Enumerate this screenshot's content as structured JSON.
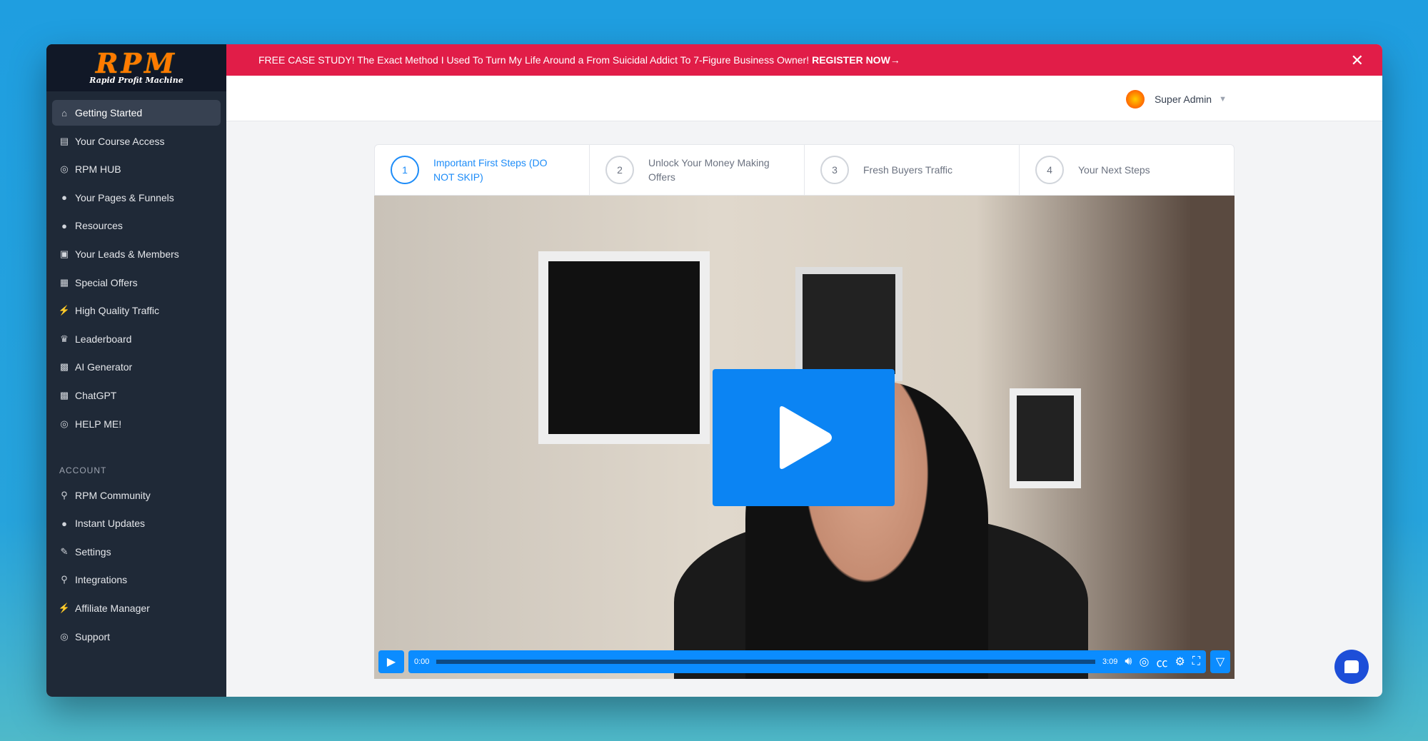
{
  "logo": {
    "main": "RPM",
    "tagline": "Rapid Profit Machine"
  },
  "banner": {
    "text": "FREE CASE STUDY! The Exact Method I Used To Turn My Life Around a From Suicidal Addict To 7-Figure Business Owner!",
    "cta": "REGISTER NOW→",
    "close": "✕"
  },
  "header": {
    "user": "Super Admin"
  },
  "sidebar": {
    "items": [
      {
        "label": "Getting Started",
        "icon": "⌂"
      },
      {
        "label": "Your Course Access",
        "icon": "▤"
      },
      {
        "label": "RPM HUB",
        "icon": "◎"
      },
      {
        "label": "Your Pages & Funnels",
        "icon": "●"
      },
      {
        "label": "Resources",
        "icon": "●"
      },
      {
        "label": "Your Leads & Members",
        "icon": "▣"
      },
      {
        "label": "Special Offers",
        "icon": "▦"
      },
      {
        "label": "High Quality Traffic",
        "icon": "⚡"
      },
      {
        "label": "Leaderboard",
        "icon": "♛"
      },
      {
        "label": "AI Generator",
        "icon": "▩"
      },
      {
        "label": "ChatGPT",
        "icon": "▩"
      },
      {
        "label": "HELP ME!",
        "icon": "◎"
      }
    ],
    "account_label": "ACCOUNT",
    "account_items": [
      {
        "label": "RPM Community",
        "icon": "⚲"
      },
      {
        "label": "Instant Updates",
        "icon": "●"
      },
      {
        "label": "Settings",
        "icon": "✎"
      },
      {
        "label": "Integrations",
        "icon": "⚲"
      },
      {
        "label": "Affiliate Manager",
        "icon": "⚡"
      },
      {
        "label": "Support",
        "icon": "◎"
      }
    ]
  },
  "steps": [
    {
      "num": "1",
      "label": "Important First Steps (DO NOT SKIP)"
    },
    {
      "num": "2",
      "label": "Unlock Your Money Making Offers"
    },
    {
      "num": "3",
      "label": "Fresh Buyers Traffic"
    },
    {
      "num": "4",
      "label": "Your Next Steps"
    }
  ],
  "video": {
    "current_time": "0:00",
    "duration": "3:09",
    "progress": 0
  }
}
